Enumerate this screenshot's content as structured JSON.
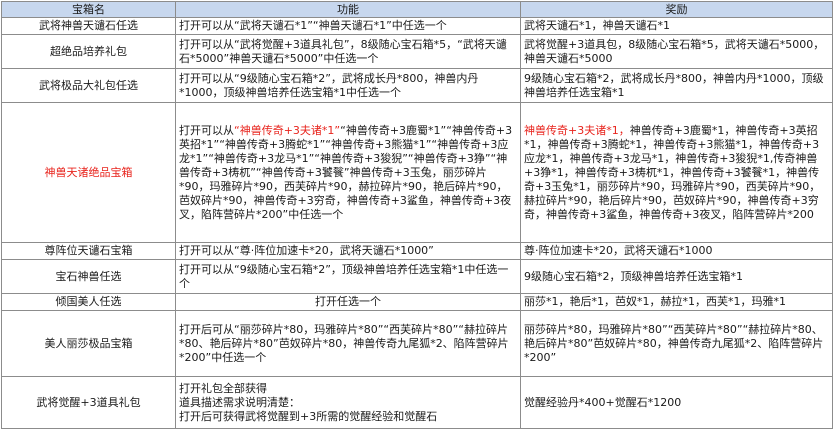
{
  "headers": {
    "name": "宝箱名",
    "func": "功能",
    "reward": "奖励"
  },
  "rows": [
    {
      "name": "武将神兽天谴石任选",
      "func": "打开可以从“武将天谴石*1”“神兽天谴石*1”中任选一个",
      "reward": "武将天谴石*1，神兽天谴石*1"
    },
    {
      "name": "超绝品培养礼包",
      "func": "打开可以从“武将觉醒+3道具礼包”，8级随心宝石箱*5，“武将天谴石*5000”神兽天谴石*5000”中任选一个",
      "reward": "武将觉醒+3道具包，8级随心宝石箱*5，武将天谴石*5000，神兽天谴石*5000"
    },
    {
      "name": "武将极品大礼包任选",
      "func": "打开可以从“9级随心宝石箱*2”，武将成长丹*800，神兽内丹*1000，顶级神兽培养任选宝箱*1中任选一个",
      "reward": "9级随心宝石箱*2，武将成长丹*800，神兽内丹*1000，顶级神兽培养任选宝箱*1"
    },
    {
      "name": "神兽天诸绝品宝箱",
      "func_red": "“神兽传奇+3夫诸*1”",
      "func_rest": "“神兽传奇+3鹿蜀*1”“神兽传奇+3英招*1”“神兽传奇+3腾蛇*1”“神兽传奇+3熊猫*1”“神兽传奇+3应龙*1”“神兽传奇+3龙马*1”“神兽传奇+3狻猊”“神兽传奇+3狰”“神兽传奇+3梼杌”“神兽传奇+3饕餮”神兽传奇+3玉兔，丽莎碎片*90，玛雅碎片*90，西芙碎片*90，赫拉碎片*90，艳后碎片*90，芭奴碎片*90，神兽传奇+3穷奇，神兽传奇+3鲨鱼，神兽传奇+3夜叉，陷阵营碎片*200”中任选一个",
      "func_prefix": "打开可以从",
      "reward_red": "神兽传奇+3夫诸*1，",
      "reward_rest": "神兽传奇+3鹿蜀*1，神兽传奇+3英招*1，神兽传奇+3腾蛇*1，神兽传奇+3熊猫*1，神兽传奇+3应龙*1，神兽传奇+3龙马*1，神兽传奇+3狻猊*1,传奇神兽+3狰*1，神兽传奇+3梼杌*1，神兽传奇+3饕餮*1，神兽传奇+3玉兔*1，丽莎碎片*90，玛雅碎片*90，西芙碎片*90，赫拉碎片*90，艳后碎片*90，芭奴碎片*90，神兽传奇+3穷奇，神兽传奇+3鲨鱼，神兽传奇+3夜叉，陷阵营碎片*200"
    },
    {
      "name": "尊阵位天谴石宝箱",
      "func": "打开可以从“尊·阵位加速卡*20，武将天谴石*1000”",
      "reward": "尊·阵位加速卡*20，武将天谴石*1000"
    },
    {
      "name": "宝石神兽任选",
      "func": "打开可以从“9级随心宝石箱*2”，顶级神兽培养任选宝箱*1中任选一个",
      "reward": "9级随心宝石箱*2，顶级神兽培养任选宝箱*1"
    },
    {
      "name": "倾国美人任选",
      "func": "打开任选一个",
      "reward": "丽莎*1，艳后*1，芭奴*1，赫拉*1，西芙*1，玛雅*1"
    },
    {
      "name": "美人丽莎极品宝箱",
      "func": "打开后可从“丽莎碎片*80，玛雅碎片*80”“西芙碎片*80”“赫拉碎片*80、艳后碎片*80”芭奴碎片*80，神兽传奇九尾狐*2、陷阵营碎片*200”中任选一个",
      "reward": "丽莎碎片*80，玛雅碎片*80”“西芙碎片*80”“赫拉碎片*80、艳后碎片*80”芭奴碎片*80，神兽传奇九尾狐*2、陷阵营碎片*200”"
    },
    {
      "name": "武将觉醒+3道具礼包",
      "func_lines": [
        "打开礼包全部获得",
        "道具描述需求说明清楚：",
        "打开后可获得武将觉醒到+3所需的觉醒经验和觉醒石"
      ],
      "reward": "觉醒经验丹*400+觉醒石*1200"
    }
  ]
}
